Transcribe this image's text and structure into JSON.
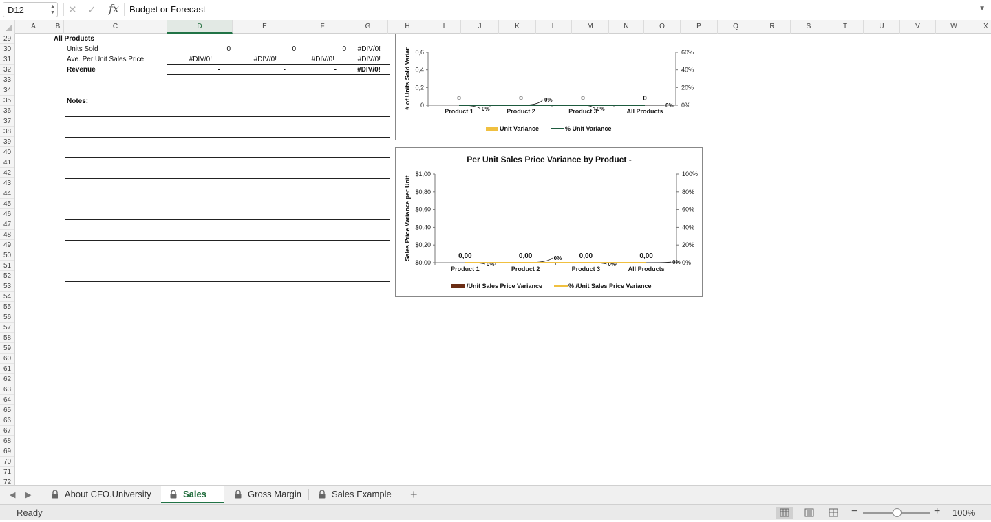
{
  "formula_bar": {
    "name_box": "D12",
    "cancel_icon": "✕",
    "enter_icon": "✓",
    "fx_label": "fx",
    "formula": "Budget  or Forecast"
  },
  "columns": [
    "A",
    "B",
    "C",
    "D",
    "E",
    "F",
    "G",
    "H",
    "I",
    "J",
    "K",
    "L",
    "M",
    "N",
    "O",
    "P",
    "Q",
    "R",
    "S",
    "T",
    "U",
    "V",
    "W",
    "X"
  ],
  "selected_column": "D",
  "rows": [
    "29",
    "30",
    "31",
    "32",
    "33",
    "34",
    "35",
    "36",
    "37",
    "38",
    "39",
    "40",
    "41",
    "42",
    "43",
    "44",
    "45",
    "46",
    "47",
    "48",
    "49",
    "50",
    "51",
    "52",
    "53",
    "54",
    "55",
    "56",
    "57",
    "58",
    "59",
    "60",
    "61",
    "62",
    "63",
    "64",
    "65",
    "66",
    "67",
    "68",
    "69",
    "70",
    "71",
    "72"
  ],
  "sheet": {
    "section_title": "All Products",
    "units_sold_label": "Units Sold",
    "ave_price_label": "Ave. Per Unit  Sales Price",
    "revenue_label": "Revenue",
    "notes_label": "Notes:",
    "units_sold_values": [
      "0",
      "0",
      "0",
      "#DIV/0!"
    ],
    "ave_price_values": [
      "#DIV/0!",
      "#DIV/0!",
      "#DIV/0!",
      "#DIV/0!"
    ],
    "revenue_values": [
      "-",
      "-",
      "-",
      "#DIV/0!"
    ]
  },
  "chart_data": [
    {
      "type": "bar",
      "title": "",
      "ylabel": "# of Units Sold Variar",
      "categories": [
        "Product 1",
        "Product 2",
        "Product 3",
        "All Products"
      ],
      "series": [
        {
          "name": "Unit Variance",
          "type": "bar",
          "values": [
            0,
            0,
            0,
            0
          ],
          "color": "#f0c040"
        },
        {
          "name": "% Unit Variance",
          "type": "line",
          "axis": "right",
          "values": [
            0,
            0,
            0,
            0
          ],
          "color": "#1e5b3f"
        }
      ],
      "y_ticks": [
        "0",
        "0,2",
        "0,4",
        "0,6"
      ],
      "y2_ticks": [
        "0%",
        "20%",
        "40%",
        "60%"
      ],
      "data_labels": [
        "0",
        "0",
        "0",
        "0"
      ],
      "pct_labels": [
        "0%",
        "0%",
        "0%",
        "0%"
      ],
      "legend": "bottom"
    },
    {
      "type": "bar",
      "title": "Per Unit Sales Price Variance by Product -",
      "ylabel": "Sales Price Variance per Unit",
      "categories": [
        "Product 1",
        "Product 2",
        "Product 3",
        "All Products"
      ],
      "series": [
        {
          "name": "/Unit Sales Price Variance",
          "type": "bar",
          "values": [
            0,
            0,
            0,
            0
          ],
          "color": "#6b2d14"
        },
        {
          "name": "% /Unit Sales Price Variance",
          "type": "line",
          "axis": "right",
          "values": [
            0,
            0,
            0,
            0
          ],
          "color": "#f0c040"
        }
      ],
      "y_ticks": [
        "$0,00",
        "$0,20",
        "$0,40",
        "$0,60",
        "$0,80",
        "$1,00"
      ],
      "y2_ticks": [
        "0%",
        "20%",
        "40%",
        "60%",
        "80%",
        "100%"
      ],
      "ylim": [
        0,
        1
      ],
      "data_labels": [
        "0,00",
        "0,00",
        "0,00",
        "0,00"
      ],
      "pct_labels": [
        "0%",
        "0%",
        "0%",
        "0%"
      ],
      "legend": "bottom"
    }
  ],
  "tabs": [
    {
      "label": "About CFO.University",
      "active": false
    },
    {
      "label": "Sales",
      "active": true
    },
    {
      "label": "Gross Margin",
      "active": false
    },
    {
      "label": "Sales Example",
      "active": false
    }
  ],
  "add_tab_label": "+",
  "status": {
    "ready": "Ready",
    "zoom": "100%",
    "zoom_minus": "−",
    "zoom_plus": "+"
  }
}
